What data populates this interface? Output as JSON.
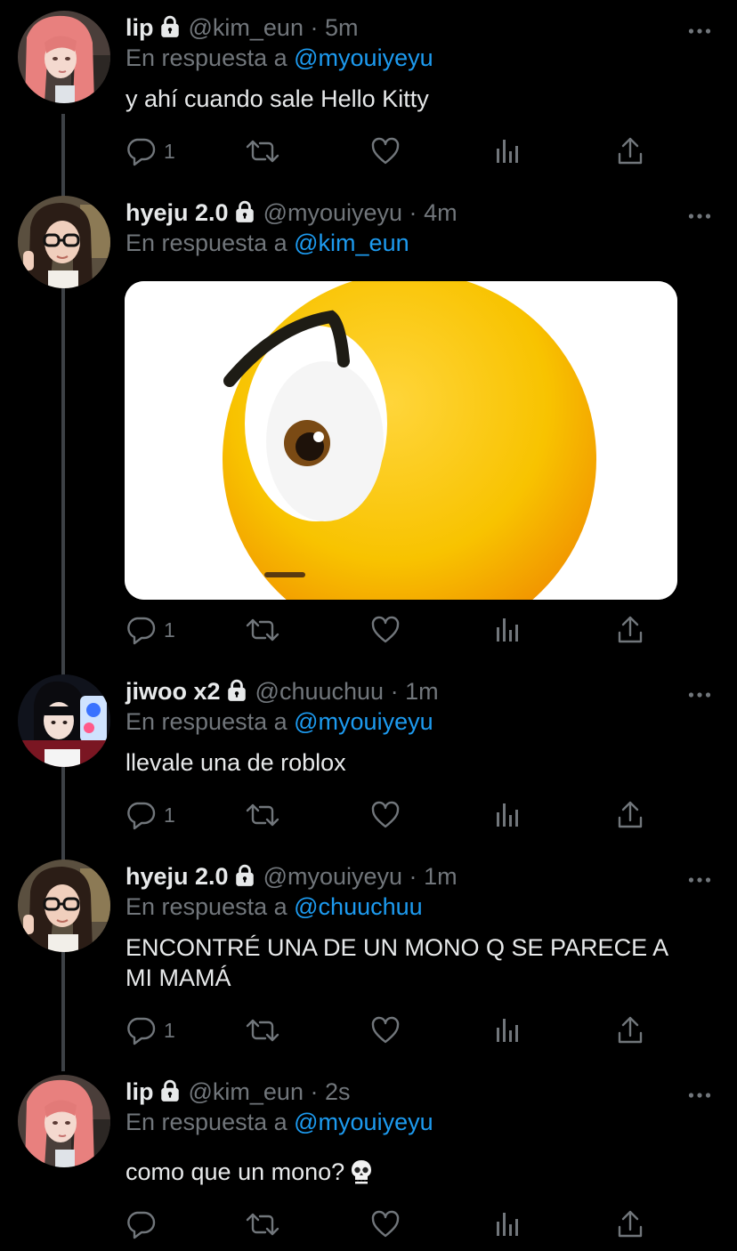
{
  "colors": {
    "background": "#000000",
    "text_primary": "#e7e9ea",
    "text_secondary": "#71767b",
    "accent_link": "#1d9bf0",
    "thread_line": "#3d4146",
    "emoji_yellow": "#f8c300"
  },
  "tweets": [
    {
      "name": "lip",
      "handle": "@kim_eun",
      "sep": "·",
      "time": "5m",
      "reply_prefix": "En respuesta a",
      "reply_to": "@myouiyeyu",
      "text": "y ahí cuando sale Hello Kitty",
      "reply_count": "1",
      "avatar": "pink-haired-woman-avatar",
      "icons": [
        "lock-icon",
        "more-icon",
        "reply-icon",
        "retweet-icon",
        "like-icon",
        "analytics-icon",
        "share-icon"
      ]
    },
    {
      "name": "hyeju 2.0",
      "handle": "@myouiyeyu",
      "sep": "·",
      "time": "4m",
      "reply_prefix": "En respuesta a",
      "reply_to": "@kim_eun",
      "media": "side-eye-emoji-image",
      "reply_count": "1",
      "avatar": "woman-with-glasses-avatar"
    },
    {
      "name": "jiwoo x2",
      "handle": "@chuuchuu",
      "sep": "·",
      "time": "1m",
      "reply_prefix": "En respuesta a",
      "reply_to": "@myouiyeyu",
      "text": "llevale una de roblox",
      "reply_count": "1",
      "avatar": "girl-with-phone-avatar"
    },
    {
      "name": "hyeju 2.0",
      "handle": "@myouiyeyu",
      "sep": "·",
      "time": "1m",
      "reply_prefix": "En respuesta a",
      "reply_to": "@chuuchuu",
      "text": "ENCONTRÉ UNA DE UN MONO Q SE PARECE A MI MAMÁ",
      "reply_count": "1",
      "avatar": "woman-with-glasses-avatar"
    },
    {
      "name": "lip",
      "handle": "@kim_eun",
      "sep": "·",
      "time": "2s",
      "reply_prefix": "En respuesta a",
      "reply_to": "@myouiyeyu",
      "text": "como que un mono?",
      "text_emoji": "skull-emoji",
      "reply_count": "",
      "avatar": "pink-haired-woman-avatar"
    }
  ]
}
